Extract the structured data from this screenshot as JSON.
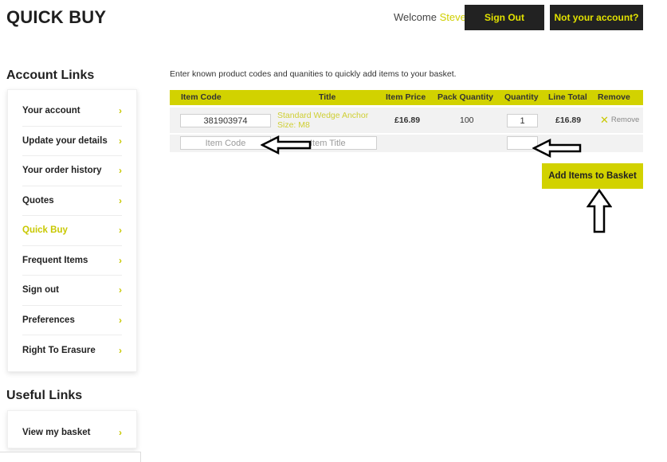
{
  "page": {
    "title": "QUICK BUY"
  },
  "header": {
    "welcome_prefix": "Welcome",
    "user_name": "Steve",
    "sign_out_label": "Sign Out",
    "not_your_account_label": "Not your account?"
  },
  "sidebar": {
    "account_heading": "Account Links",
    "account_items": [
      {
        "label": "Your account",
        "active": false
      },
      {
        "label": "Update your details",
        "active": false
      },
      {
        "label": "Your order history",
        "active": false
      },
      {
        "label": "Quotes",
        "active": false
      },
      {
        "label": "Quick Buy",
        "active": true
      },
      {
        "label": "Frequent Items",
        "active": false
      },
      {
        "label": "Sign out",
        "active": false
      },
      {
        "label": "Preferences",
        "active": false
      },
      {
        "label": "Right To Erasure",
        "active": false
      }
    ],
    "useful_heading": "Useful Links",
    "useful_items": [
      {
        "label": "View my basket",
        "active": false
      }
    ],
    "chevron": "›"
  },
  "main": {
    "intro": "Enter known product codes and quanities to quickly add items to your basket.",
    "columns": [
      "Item Code",
      "Title",
      "Item Price",
      "Pack Quantity",
      "Quantity",
      "Line Total",
      "Remove"
    ],
    "rows": [
      {
        "item_code": "381903974",
        "title_line1": "Standard Wedge Anchor",
        "title_line2": "Size: M8",
        "item_price": "£16.89",
        "pack_quantity": "100",
        "quantity": "1",
        "line_total": "£16.89",
        "remove_label": "Remove"
      }
    ],
    "new_row": {
      "item_code_placeholder": "Item Code",
      "item_title_placeholder": "Item Title",
      "quantity_value": ""
    },
    "add_button_label": "Add Items to Basket"
  },
  "colors": {
    "accent": "#d2d200",
    "dark": "#222222"
  }
}
